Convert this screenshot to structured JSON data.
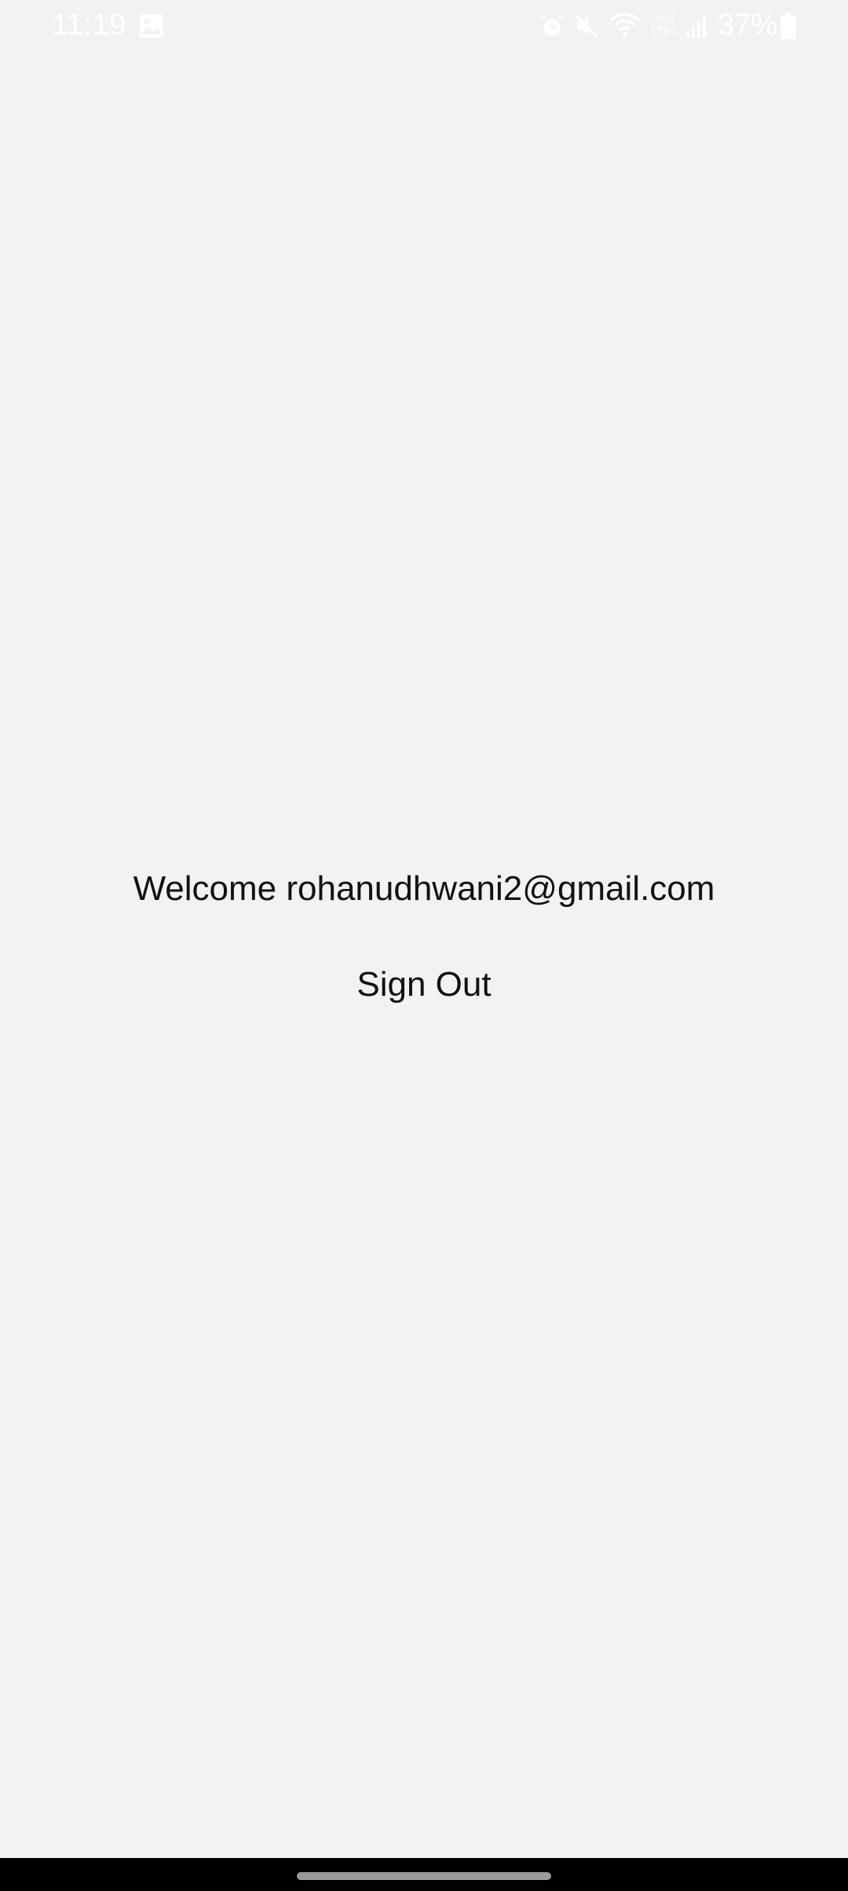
{
  "status_bar": {
    "time": "11:19",
    "battery_percent": "37%",
    "icons": [
      "image-icon",
      "alarm-icon",
      "mute-icon",
      "wifi-icon",
      "volte-lte-icon",
      "signal-icon",
      "battery-icon"
    ],
    "network_label_top": "Vo))",
    "network_label_bottom": "LTE1"
  },
  "main": {
    "welcome_text": "Welcome rohanudhwani2@gmail.com",
    "sign_out_label": "Sign Out"
  },
  "colors": {
    "background": "#f2f2f2",
    "text": "#111111",
    "nav_bar": "#000000"
  }
}
